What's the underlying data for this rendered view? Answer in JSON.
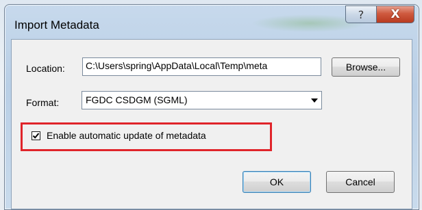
{
  "dialog": {
    "title": "Import Metadata",
    "help_label": "?",
    "close_label": "X"
  },
  "location": {
    "label": "Location:",
    "value": "C:\\Users\\spring\\AppData\\Local\\Temp\\meta",
    "browse_label": "Browse..."
  },
  "format": {
    "label": "Format:",
    "selected": "FGDC CSDGM (SGML)"
  },
  "options": {
    "auto_update_label": "Enable automatic update of metadata",
    "auto_update_checked": true,
    "highlight_color": "#e0242a"
  },
  "actions": {
    "ok_label": "OK",
    "cancel_label": "Cancel"
  }
}
